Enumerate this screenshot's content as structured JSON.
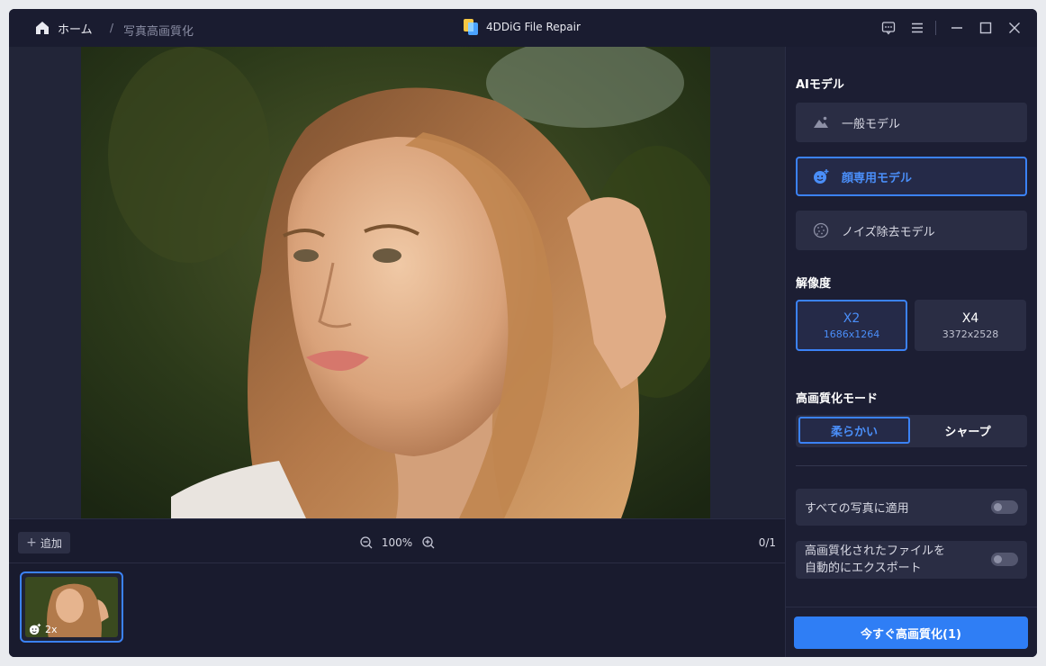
{
  "titlebar": {
    "home_label": "ホーム",
    "breadcrumb_separator": "/",
    "breadcrumb_current": "写真高画質化",
    "app_name": "4DDiG File Repair"
  },
  "preview": {
    "add_label": "追加",
    "zoom_level": "100%",
    "page_count": "0/1"
  },
  "thumbnails": [
    {
      "badge": "2x"
    }
  ],
  "side_panel": {
    "ai_model_title": "AIモデル",
    "models": [
      {
        "label": "一般モデル",
        "icon": "landscape-icon",
        "selected": false
      },
      {
        "label": "顔専用モデル",
        "icon": "face-icon",
        "selected": true
      },
      {
        "label": "ノイズ除去モデル",
        "icon": "noise-icon",
        "selected": false
      }
    ],
    "resolution_title": "解像度",
    "resolutions": [
      {
        "scale": "X2",
        "size": "1686x1264",
        "selected": true
      },
      {
        "scale": "X4",
        "size": "3372x2528",
        "selected": false
      }
    ],
    "mode_title": "高画質化モード",
    "modes": [
      {
        "label": "柔らかい",
        "selected": true
      },
      {
        "label": "シャープ",
        "selected": false
      }
    ],
    "apply_all_label": "すべての写真に適用",
    "apply_all_enabled": false,
    "auto_export_line1": "高画質化されたファイルを",
    "auto_export_line2": "自動的にエクスポート",
    "auto_export_enabled": false,
    "enhance_button": "今すぐ高画質化(1)"
  },
  "colors": {
    "accent": "#3b82f6",
    "button": "#2f7ef5",
    "background": "#1c1e33",
    "card": "#2a2d44"
  }
}
